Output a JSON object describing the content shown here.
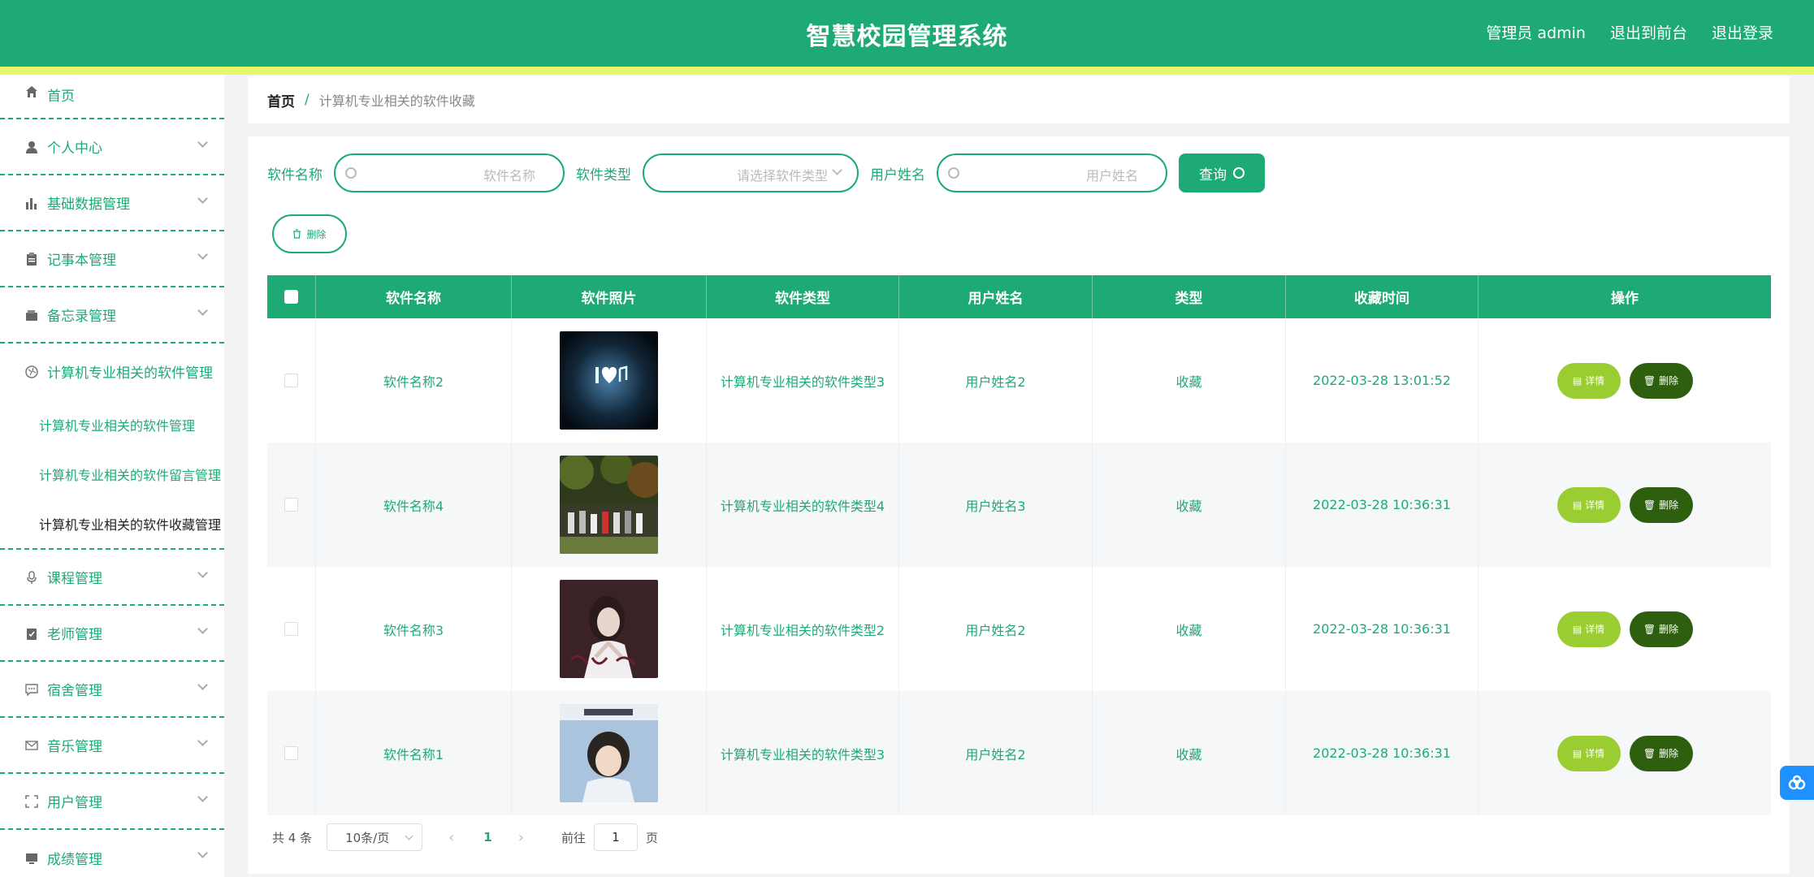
{
  "header": {
    "title": "智慧校园管理系统",
    "actions": [
      "管理员 admin",
      "退出到前台",
      "退出登录"
    ]
  },
  "sidebar": {
    "items": [
      {
        "label": "首页",
        "icon": "home-icon"
      },
      {
        "label": "个人中心",
        "icon": "user-icon"
      },
      {
        "label": "基础数据管理",
        "icon": "bar-chart-icon"
      },
      {
        "label": "记事本管理",
        "icon": "clipboard-icon"
      },
      {
        "label": "备忘录管理",
        "icon": "wallet-icon"
      },
      {
        "label": "计算机专业相关的软件管理",
        "icon": "globe-icon"
      },
      {
        "label": "课程管理",
        "icon": "microphone-icon"
      },
      {
        "label": "老师管理",
        "icon": "clipboard-check-icon"
      },
      {
        "label": "宿舍管理",
        "icon": "chat-icon"
      },
      {
        "label": "音乐管理",
        "icon": "mail-icon"
      },
      {
        "label": "用户管理",
        "icon": "fullscreen-icon"
      },
      {
        "label": "成绩管理",
        "icon": "monitor-icon"
      }
    ],
    "submenu": [
      "计算机专业相关的软件管理",
      "计算机专业相关的软件留言管理",
      "计算机专业相关的软件收藏管理"
    ]
  },
  "breadcrumb": {
    "home": "首页",
    "separator": "/",
    "current": "计算机专业相关的软件收藏"
  },
  "search": {
    "name_label": "软件名称",
    "name_placeholder": "软件名称",
    "type_label": "软件类型",
    "type_placeholder": "请选择软件类型",
    "user_label": "用户姓名",
    "user_placeholder": "用户姓名",
    "query_label": "查询"
  },
  "toolbar": {
    "delete_label": "删除"
  },
  "table": {
    "headers": [
      "软件名称",
      "软件照片",
      "软件类型",
      "用户姓名",
      "类型",
      "收藏时间",
      "操作"
    ],
    "rows": [
      {
        "name": "软件名称2",
        "type": "计算机专业相关的软件类型3",
        "user": "用户姓名2",
        "kind": "收藏",
        "time": "2022-03-28 13:01:52"
      },
      {
        "name": "软件名称4",
        "type": "计算机专业相关的软件类型4",
        "user": "用户姓名3",
        "kind": "收藏",
        "time": "2022-03-28 10:36:31"
      },
      {
        "name": "软件名称3",
        "type": "计算机专业相关的软件类型2",
        "user": "用户姓名2",
        "kind": "收藏",
        "time": "2022-03-28 10:36:31"
      },
      {
        "name": "软件名称1",
        "type": "计算机专业相关的软件类型3",
        "user": "用户姓名2",
        "kind": "收藏",
        "time": "2022-03-28 10:36:31"
      }
    ],
    "detail_label": "详情",
    "delete_label": "删除"
  },
  "pagination": {
    "total": "共 4 条",
    "page_size": "10条/页",
    "current_page": "1",
    "goto_label": "前往",
    "goto_value": "1",
    "page_suffix": "页"
  },
  "colors": {
    "primary": "#1eaa74",
    "accent_stripe": "#e6f76a",
    "detail_button": "#9acd32",
    "delete_button": "#2e5f0e"
  }
}
